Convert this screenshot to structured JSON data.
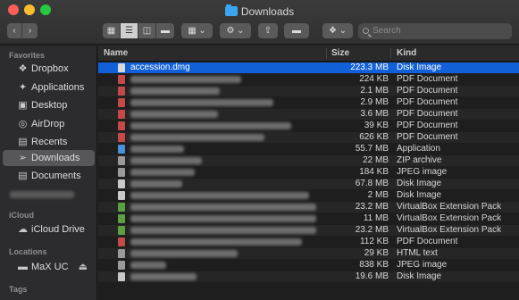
{
  "window": {
    "title": "Downloads",
    "search_placeholder": "Search"
  },
  "sidebar": {
    "favorites_header": "Favorites",
    "favorites": [
      {
        "label": "Dropbox",
        "icon": "dropbox-icon"
      },
      {
        "label": "Applications",
        "icon": "applications-icon"
      },
      {
        "label": "Desktop",
        "icon": "desktop-icon"
      },
      {
        "label": "AirDrop",
        "icon": "airdrop-icon"
      },
      {
        "label": "Recents",
        "icon": "recents-icon"
      },
      {
        "label": "Downloads",
        "icon": "downloads-icon",
        "selected": true
      },
      {
        "label": "Documents",
        "icon": "documents-icon"
      }
    ],
    "icloud_header": "iCloud",
    "icloud_drive": "iCloud Drive",
    "locations_header": "Locations",
    "locations_item": "MaX UC",
    "tags_header": "Tags"
  },
  "list": {
    "headers": {
      "name": "Name",
      "size": "Size",
      "kind": "Kind"
    },
    "rows": [
      {
        "name": "accession.dmg",
        "size": "223.3 MB",
        "kind": "Disk Image",
        "selected": true,
        "icon_color": "#d9d9d9"
      },
      {
        "size": "224 KB",
        "kind": "PDF Document",
        "icon_color": "#c44a4a"
      },
      {
        "size": "2.1 MB",
        "kind": "PDF Document",
        "icon_color": "#c44a4a"
      },
      {
        "size": "2.9 MB",
        "kind": "PDF Document",
        "icon_color": "#c44a4a"
      },
      {
        "size": "3.6 MB",
        "kind": "PDF Document",
        "icon_color": "#c44a4a"
      },
      {
        "size": "39 KB",
        "kind": "PDF Document",
        "icon_color": "#c44a4a"
      },
      {
        "size": "626 KB",
        "kind": "PDF Document",
        "icon_color": "#c44a4a"
      },
      {
        "size": "55.7 MB",
        "kind": "Application",
        "icon_color": "#4a8fd9"
      },
      {
        "size": "22 MB",
        "kind": "ZIP archive",
        "icon_color": "#9a9a9a"
      },
      {
        "size": "184 KB",
        "kind": "JPEG image",
        "icon_color": "#9a9a9a"
      },
      {
        "size": "67.8 MB",
        "kind": "Disk Image",
        "icon_color": "#c9c9c9"
      },
      {
        "size": "2 MB",
        "kind": "Disk Image",
        "icon_color": "#c9c9c9"
      },
      {
        "size": "23.2 MB",
        "kind": "VirtualBox Extension Pack",
        "icon_color": "#5aa040"
      },
      {
        "size": "11 MB",
        "kind": "VirtualBox Extension Pack",
        "icon_color": "#5aa040"
      },
      {
        "size": "23.2 MB",
        "kind": "VirtualBox Extension Pack",
        "icon_color": "#5aa040"
      },
      {
        "size": "112 KB",
        "kind": "PDF Document",
        "icon_color": "#c44a4a"
      },
      {
        "size": "29 KB",
        "kind": "HTML text",
        "icon_color": "#9a9a9a"
      },
      {
        "size": "838 KB",
        "kind": "JPEG image",
        "icon_color": "#9a9a9a"
      },
      {
        "size": "19.6 MB",
        "kind": "Disk Image",
        "icon_color": "#c9c9c9"
      }
    ]
  },
  "colors": {
    "selection": "#1160d8",
    "close": "#fc5f57",
    "minimize": "#fdbc2e",
    "maximize": "#28c840"
  }
}
